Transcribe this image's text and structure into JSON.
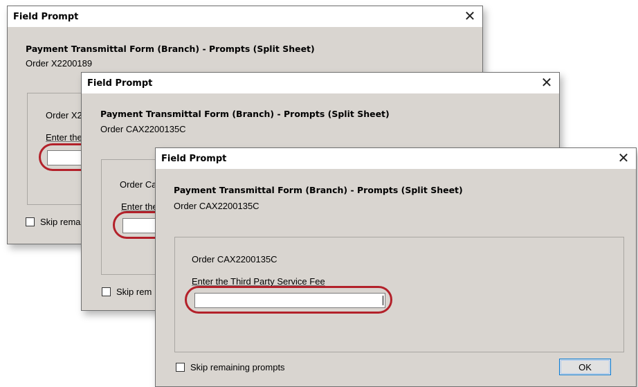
{
  "dialogs": [
    {
      "title": "Field Prompt",
      "heading": "Payment Transmittal Form (Branch) - Prompts (Split Sheet)",
      "order": "Order X2200189",
      "group_order": "Order X2",
      "field_label": "Enter the",
      "skip_label": "Skip rema",
      "close_glyph": "✕"
    },
    {
      "title": "Field Prompt",
      "heading": "Payment Transmittal Form (Branch) - Prompts (Split Sheet)",
      "order": "Order CAX2200135C",
      "group_order": "Order Ca",
      "field_label": "Enter the",
      "skip_label": "Skip rem",
      "close_glyph": "✕"
    },
    {
      "title": "Field Prompt",
      "heading": "Payment Transmittal Form (Branch) - Prompts (Split Sheet)",
      "order": "Order CAX2200135C",
      "group_order": "Order CAX2200135C",
      "field_label": "Enter the Third Party Service Fee",
      "field_value": "",
      "skip_label": "Skip remaining prompts",
      "ok_label": "OK",
      "close_glyph": "✕"
    }
  ],
  "colors": {
    "dialog_bg": "#d9d5d0",
    "highlight": "#b3212a",
    "ok_border": "#0078d7"
  }
}
